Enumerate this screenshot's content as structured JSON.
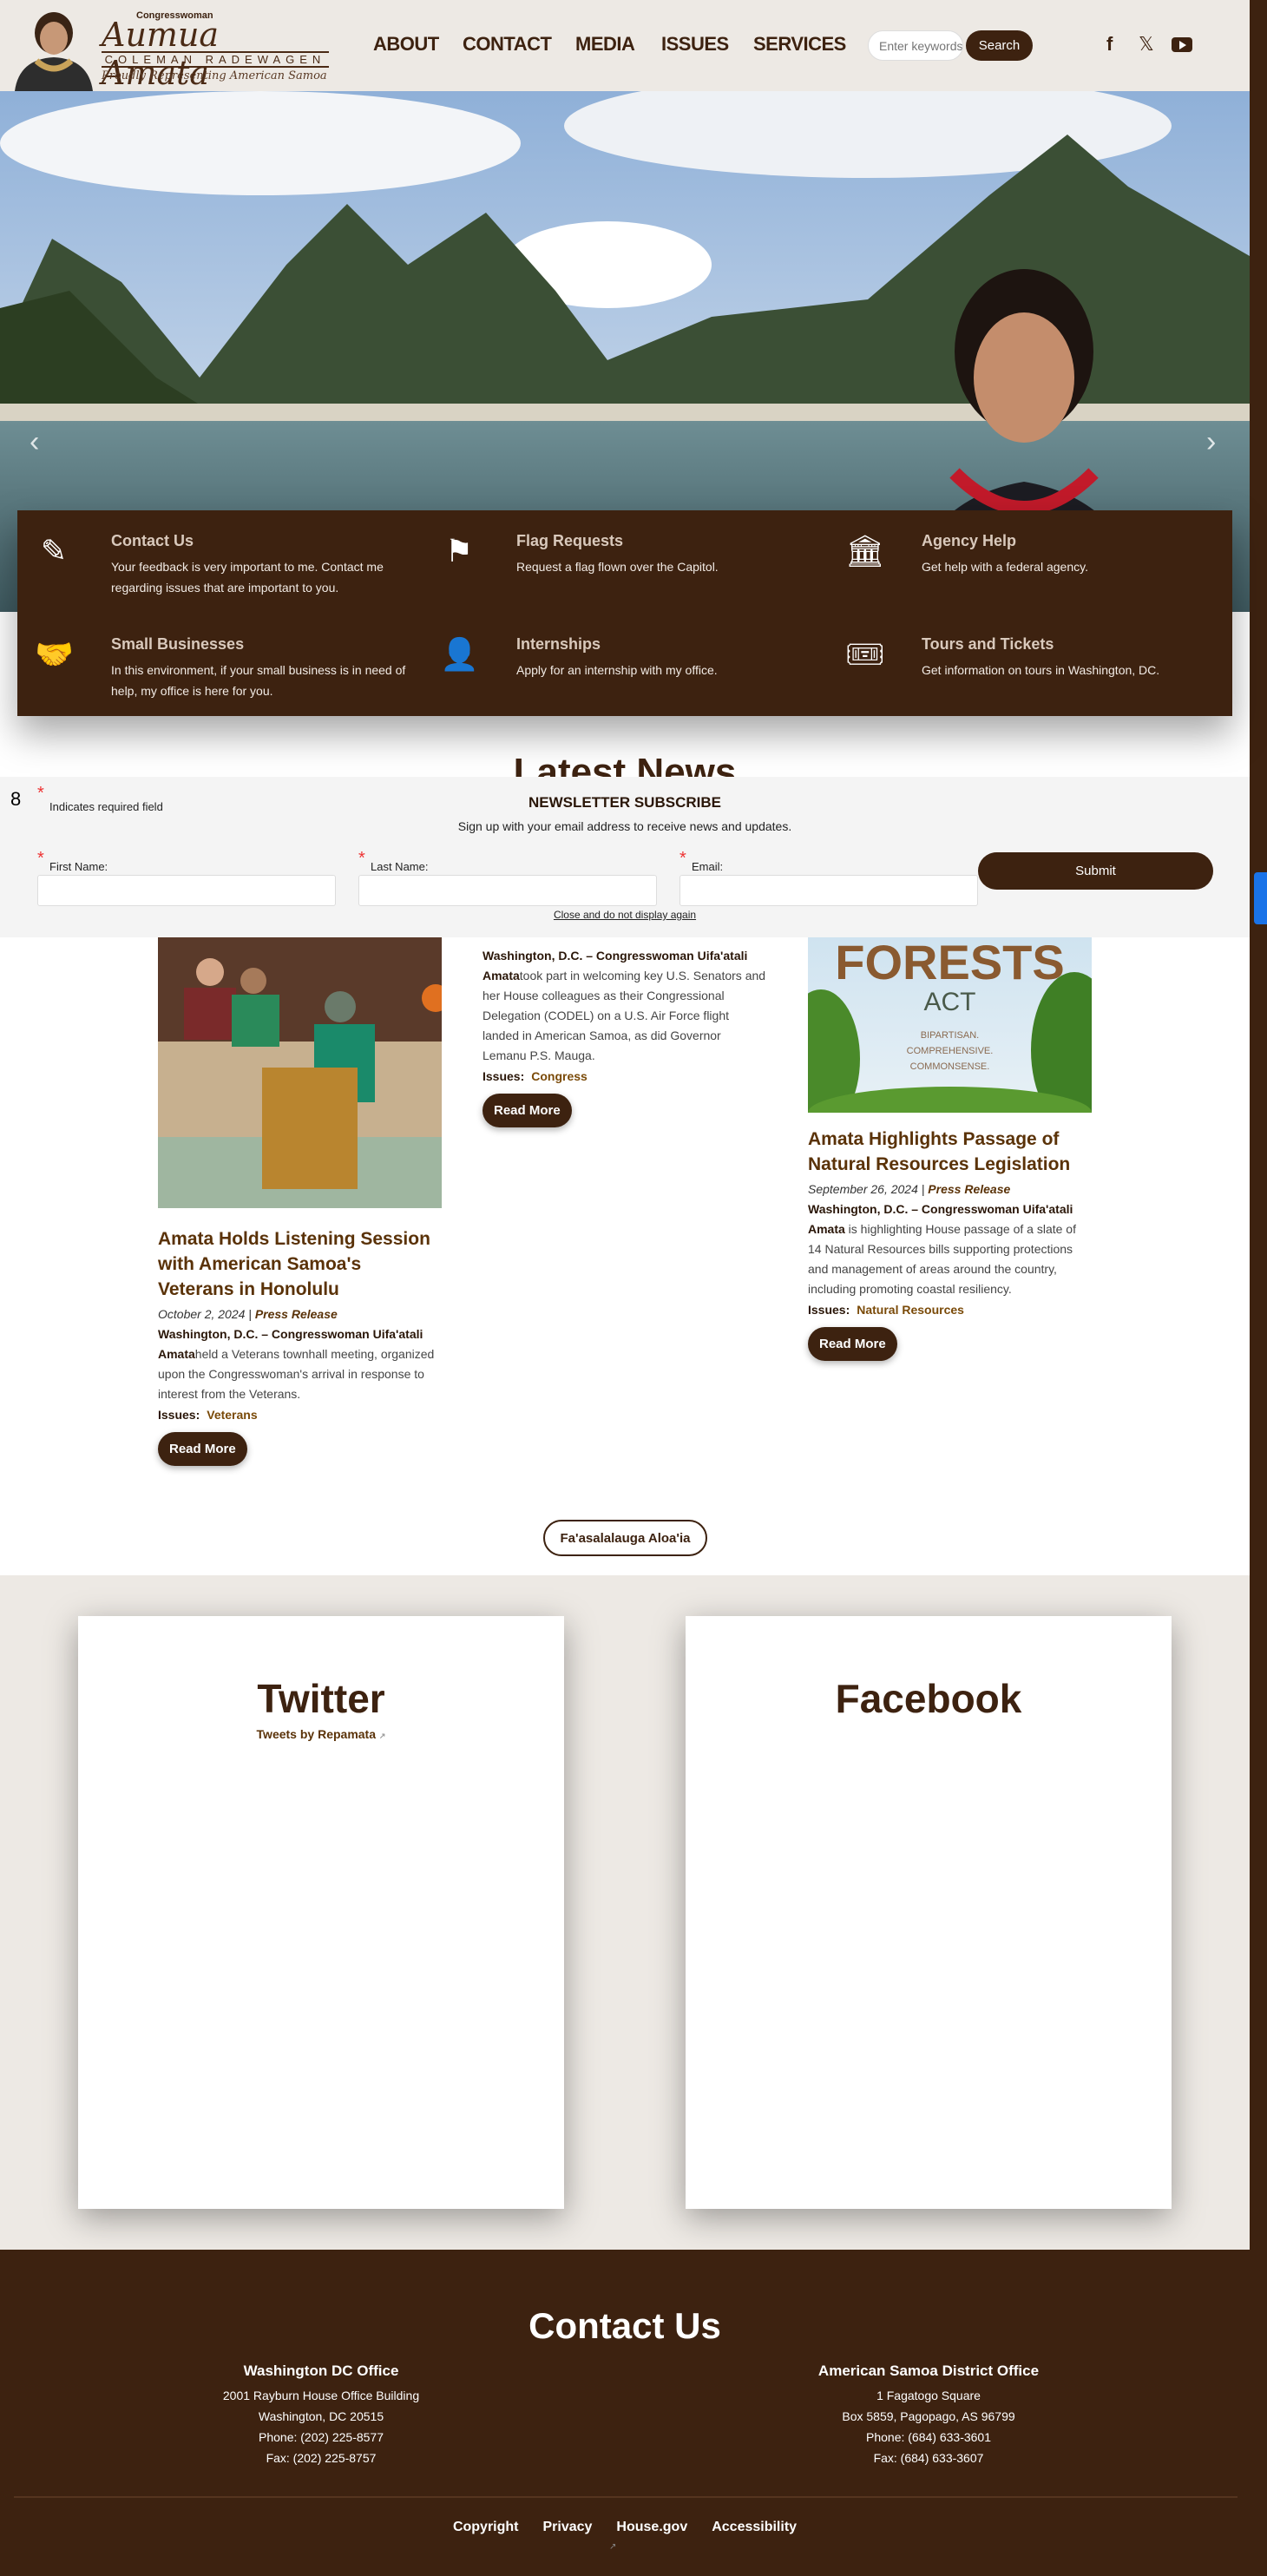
{
  "header": {
    "logo": {
      "small": "Congresswoman",
      "name": "Aumua Amata",
      "surname": "COLEMAN RADEWAGEN",
      "tagline": "Proudly Representing American Samoa"
    },
    "nav": [
      "ABOUT",
      "CONTACT",
      "MEDIA",
      "ISSUES",
      "SERVICES"
    ],
    "search": {
      "placeholder": "Enter keywords",
      "button": "Search"
    },
    "social_icons": [
      "facebook-icon",
      "x-icon",
      "youtube-icon"
    ]
  },
  "hero": {
    "slides": 3,
    "active_slide": 2
  },
  "services": [
    {
      "icon": "edit-icon",
      "title": "Contact Us",
      "desc": "Your feedback is very important to me. Contact me regarding issues that are important to you."
    },
    {
      "icon": "flag-icon",
      "title": "Flag Requests",
      "desc": "Request a flag flown over the Capitol."
    },
    {
      "icon": "capitol-icon",
      "title": "Agency Help",
      "desc": "Get help with a federal agency."
    },
    {
      "icon": "handshake-icon",
      "title": "Small Businesses",
      "desc": "In this environment, if your small business is in need of help, my office is here for you."
    },
    {
      "icon": "intern-icon",
      "title": "Internships",
      "desc": "Apply for an internship with my office."
    },
    {
      "icon": "ticket-icon",
      "title": "Tours and Tickets",
      "desc": "Get information on tours in Washington, DC."
    }
  ],
  "latest_title": "Latest News",
  "newsletter": {
    "badge": "8",
    "required_note": "Indicates required field",
    "title": "NEWSLETTER SUBSCRIBE",
    "subtitle": "Sign up with your email address to receive news and updates.",
    "fields": [
      "First Name:",
      "Last Name:",
      "Email:"
    ],
    "submit": "Submit",
    "close": "Close and do not display again"
  },
  "news": [
    {
      "title": "Amata Holds Listening Session with American Samoa's Veterans in Honolulu",
      "date": "October 2, 2024",
      "type": "Press Release",
      "lead": "Washington, D.C. – Congresswoman Uifa'atali Amata",
      "body": "held a Veterans townhall meeting, organized upon the Congresswoman's arrival in response to interest from the Veterans.",
      "issues_label": "Issues:",
      "issue": "Veterans",
      "read_more": "Read More"
    },
    {
      "lead": "Washington, D.C. – Congresswoman Uifa'atali Amata",
      "body": "took part in welcoming key U.S. Senators and her House colleagues as their Congressional Delegation (CODEL) on a U.S. Air Force flight landed in American Samoa, as did Governor Lemanu P.S. Mauga.",
      "issues_label": "Issues:",
      "issue": "Congress",
      "read_more": "Read More"
    },
    {
      "title": "Amata Highlights Passage of Natural Resources Legislation",
      "date": "September 26, 2024",
      "type": "Press Release",
      "lead": "Washington, D.C. – Congresswoman Uifa'atali Amata",
      "body": " is highlighting House passage of a slate of 14 Natural Resources bills supporting protections and management of areas around the country, including promoting coastal resiliency.",
      "issues_label": "Issues:",
      "issue": "Natural Resources",
      "read_more": "Read More",
      "image_text": {
        "a": "FORESTS",
        "b": "ACT",
        "c": "BIPARTISAN.",
        "d": "COMPREHENSIVE.",
        "e": "COMMONSENSE."
      }
    }
  ],
  "archive_button": "Fa'asalalauga Aloa'ia",
  "social": {
    "twitter_title": "Twitter",
    "twitter_link": "Tweets by Repamata",
    "facebook_title": "Facebook"
  },
  "footer": {
    "title": "Contact Us",
    "offices": [
      {
        "name": "Washington DC Office",
        "lines": [
          "2001 Rayburn House Office Building",
          "Washington, DC 20515",
          "Phone: (202) 225-8577",
          "Fax: (202) 225-8757"
        ]
      },
      {
        "name": "American Samoa District Office",
        "lines": [
          "1 Fagatogo Square",
          "Box 5859, Pagopago, AS 96799",
          "Phone: (684) 633-3601",
          "Fax: (684) 633-3607"
        ]
      }
    ],
    "links": [
      "Copyright",
      "Privacy",
      "House.gov",
      "Accessibility"
    ]
  },
  "colors": {
    "brand": "#3d2210",
    "header_bg": "#ede9e4",
    "link": "#7a4a08"
  }
}
